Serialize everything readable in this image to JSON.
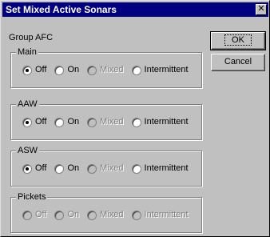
{
  "window": {
    "title": "Set Mixed Active Sonars",
    "close_glyph": "✕"
  },
  "group_afc_label": "Group AFC",
  "groups": [
    {
      "label": "Main",
      "options": [
        {
          "label": "Off",
          "checked": true,
          "disabled": false
        },
        {
          "label": "On",
          "checked": false,
          "disabled": false
        },
        {
          "label": "Mixed",
          "checked": false,
          "disabled": true
        },
        {
          "label": "Intermittent",
          "checked": false,
          "disabled": false
        }
      ]
    },
    {
      "label": "AAW",
      "options": [
        {
          "label": "Off",
          "checked": true,
          "disabled": false
        },
        {
          "label": "On",
          "checked": false,
          "disabled": false
        },
        {
          "label": "Mixed",
          "checked": false,
          "disabled": true
        },
        {
          "label": "Intermittent",
          "checked": false,
          "disabled": false
        }
      ]
    },
    {
      "label": "ASW",
      "options": [
        {
          "label": "Off",
          "checked": true,
          "disabled": false
        },
        {
          "label": "On",
          "checked": false,
          "disabled": false
        },
        {
          "label": "Mixed",
          "checked": false,
          "disabled": true
        },
        {
          "label": "Intermittent",
          "checked": false,
          "disabled": false
        }
      ]
    },
    {
      "label": "Pickets",
      "options": [
        {
          "label": "Off",
          "checked": false,
          "disabled": true
        },
        {
          "label": "On",
          "checked": false,
          "disabled": true
        },
        {
          "label": "Mixed",
          "checked": false,
          "disabled": true
        },
        {
          "label": "Intermittent",
          "checked": false,
          "disabled": true
        }
      ]
    }
  ],
  "buttons": {
    "ok": "OK",
    "cancel": "Cancel"
  }
}
